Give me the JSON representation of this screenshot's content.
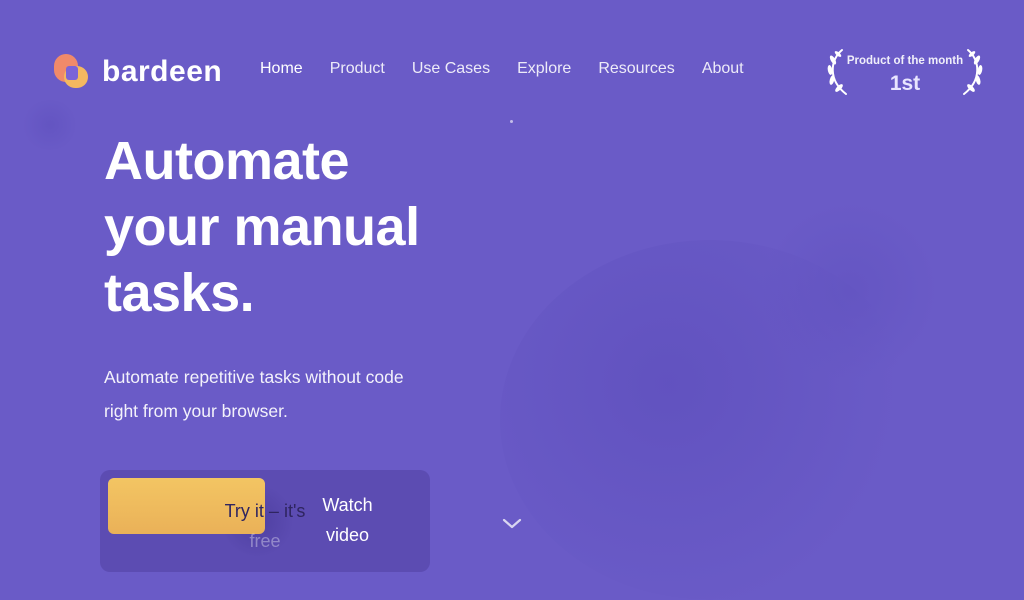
{
  "brand": {
    "name": "bardeen"
  },
  "nav": {
    "items": [
      {
        "label": "Home",
        "active": true
      },
      {
        "label": "Product"
      },
      {
        "label": "Use Cases"
      },
      {
        "label": "Explore"
      },
      {
        "label": "Resources"
      },
      {
        "label": "About"
      }
    ]
  },
  "award": {
    "title": "Product of the month",
    "rank": "1st",
    "icon": "laurel-wreath-icon"
  },
  "hero": {
    "title_lines": [
      "Automate",
      "your manual",
      "tasks."
    ],
    "subtitle": "Automate repetitive tasks without code right from your browser."
  },
  "cta": {
    "primary_line1": "Try it – it's",
    "primary_line2": "free",
    "secondary_line1": "Watch",
    "secondary_line2": "video"
  },
  "scroll_icon": "chevron-down-icon",
  "colors": {
    "background": "#6a5bc7",
    "primary_button": "#f3c563",
    "logo_orange": "#f08a6a",
    "logo_yellow": "#f4b860"
  }
}
